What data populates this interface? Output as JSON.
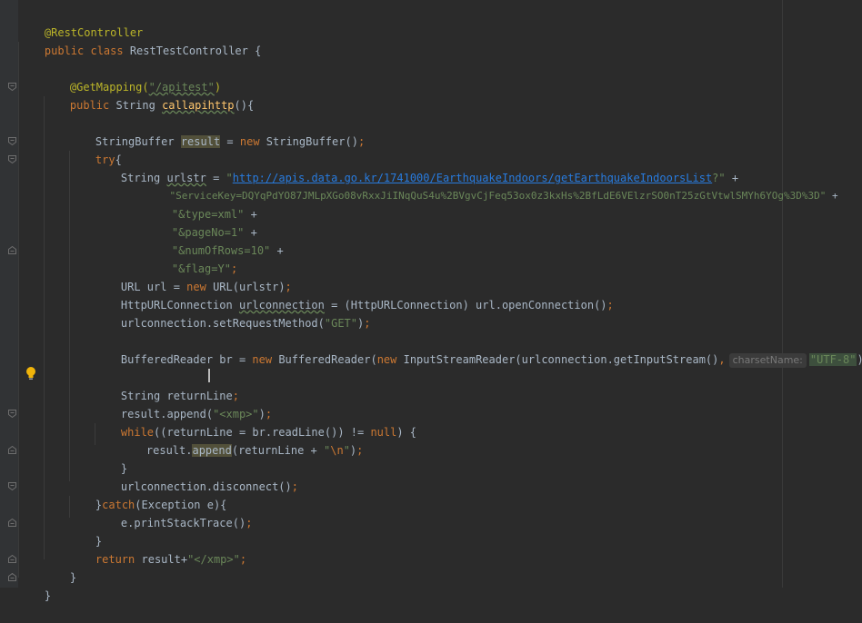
{
  "code": {
    "l1_annotation": "@RestController",
    "l2_public": "public class",
    "l2_classname": " RestTestController {",
    "l4_annotation": "@GetMapping(",
    "l4_path": "\"/apitest\"",
    "l4_close": ")",
    "l5_public": "public",
    "l5_type": " String ",
    "l5_method": "callapihttp",
    "l5_paren": "(){",
    "l7_type": "StringBuffer ",
    "l7_var": "result",
    "l7_eq": " = ",
    "l7_new": "new",
    "l7_ctor": " StringBuffer()",
    "l7_semi": ";",
    "l8_try": "try",
    "l8_brace": "{",
    "l9_type": "String ",
    "l9_var": "urlstr",
    "l9_eq": " = ",
    "l9_q1": "\"",
    "l9_url": "http://apis.data.go.kr/1741000/EarthquakeIndoors/getEarthquakeIndoorsList",
    "l9_q2": "?\"",
    "l9_plus": " +",
    "l10_str": "\"ServiceKey=DQYqPdYO87JMLpXGo08vRxxJiINqQuS4u%2BVgvCjFeq53ox0z3kxHs%2BfLdE6VElzrSO0nT25zGtVtwlSMYh6YOg%3D%3D\"",
    "l10_plus": " +",
    "l11_str": "\"&type=xml\"",
    "l11_plus": " +",
    "l12_str": "\"&pageNo=1\"",
    "l12_plus": " +",
    "l13_str": "\"&numOfRows=10\"",
    "l13_plus": " +",
    "l14_str": "\"&flag=Y\"",
    "l14_semi": ";",
    "l15_a": "URL url = ",
    "l15_new": "new",
    "l15_b": " URL(urlstr)",
    "l15_semi": ";",
    "l16_a": "HttpURLConnection ",
    "l16_var": "urlconnection",
    "l16_b": " = (HttpURLConnection) url.openConnection()",
    "l16_semi": ";",
    "l17_a": "urlconnection.setRequestMethod(",
    "l17_str": "\"GET\"",
    "l17_b": ")",
    "l17_semi": ";",
    "l19_a": "BufferedReader br = ",
    "l19_new1": "new",
    "l19_b": " BufferedReader(",
    "l19_new2": "new",
    "l19_c": " InputStreamReader(urlconnection.getInputStream()",
    "l19_comma": ",",
    "l19_hint": "charsetName:",
    "l19_str": "\"UTF-8\"",
    "l19_d": "))",
    "l19_semi": ";",
    "l21_a": "String returnLine",
    "l21_semi": ";",
    "l22_a": "result.append(",
    "l22_str": "\"<xmp>\"",
    "l22_b": ")",
    "l22_semi": ";",
    "l23_while": "while",
    "l23_a": "((returnLine = br.readLine()) != ",
    "l23_null": "null",
    "l23_b": ") {",
    "l24_a": "result.",
    "l24_method": "append",
    "l24_b": "(returnLine + ",
    "l24_q1": "\"",
    "l24_esc": "\\n",
    "l24_q2": "\"",
    "l24_c": ")",
    "l24_semi": ";",
    "l25": "}",
    "l26_a": "urlconnection.disconnect()",
    "l26_semi": ";",
    "l27_a": "}",
    "l27_catch": "catch",
    "l27_b": "(Exception e){",
    "l28_a": "e.printStackTrace()",
    "l28_semi": ";",
    "l29": "}",
    "l30_return": "return",
    "l30_a": " result+",
    "l30_str": "\"</xmp>\"",
    "l30_semi": ";",
    "l31": "}",
    "l32": "}"
  },
  "colors": {
    "background": "#2b2b2b",
    "keyword": "#cc7832",
    "string": "#6a8759",
    "annotation": "#bbb529",
    "method": "#ffc66d",
    "link": "#287bde",
    "text": "#a9b7c6"
  },
  "icons": {
    "bulb": "lightbulb-icon",
    "fold": "fold-marker-icon"
  }
}
